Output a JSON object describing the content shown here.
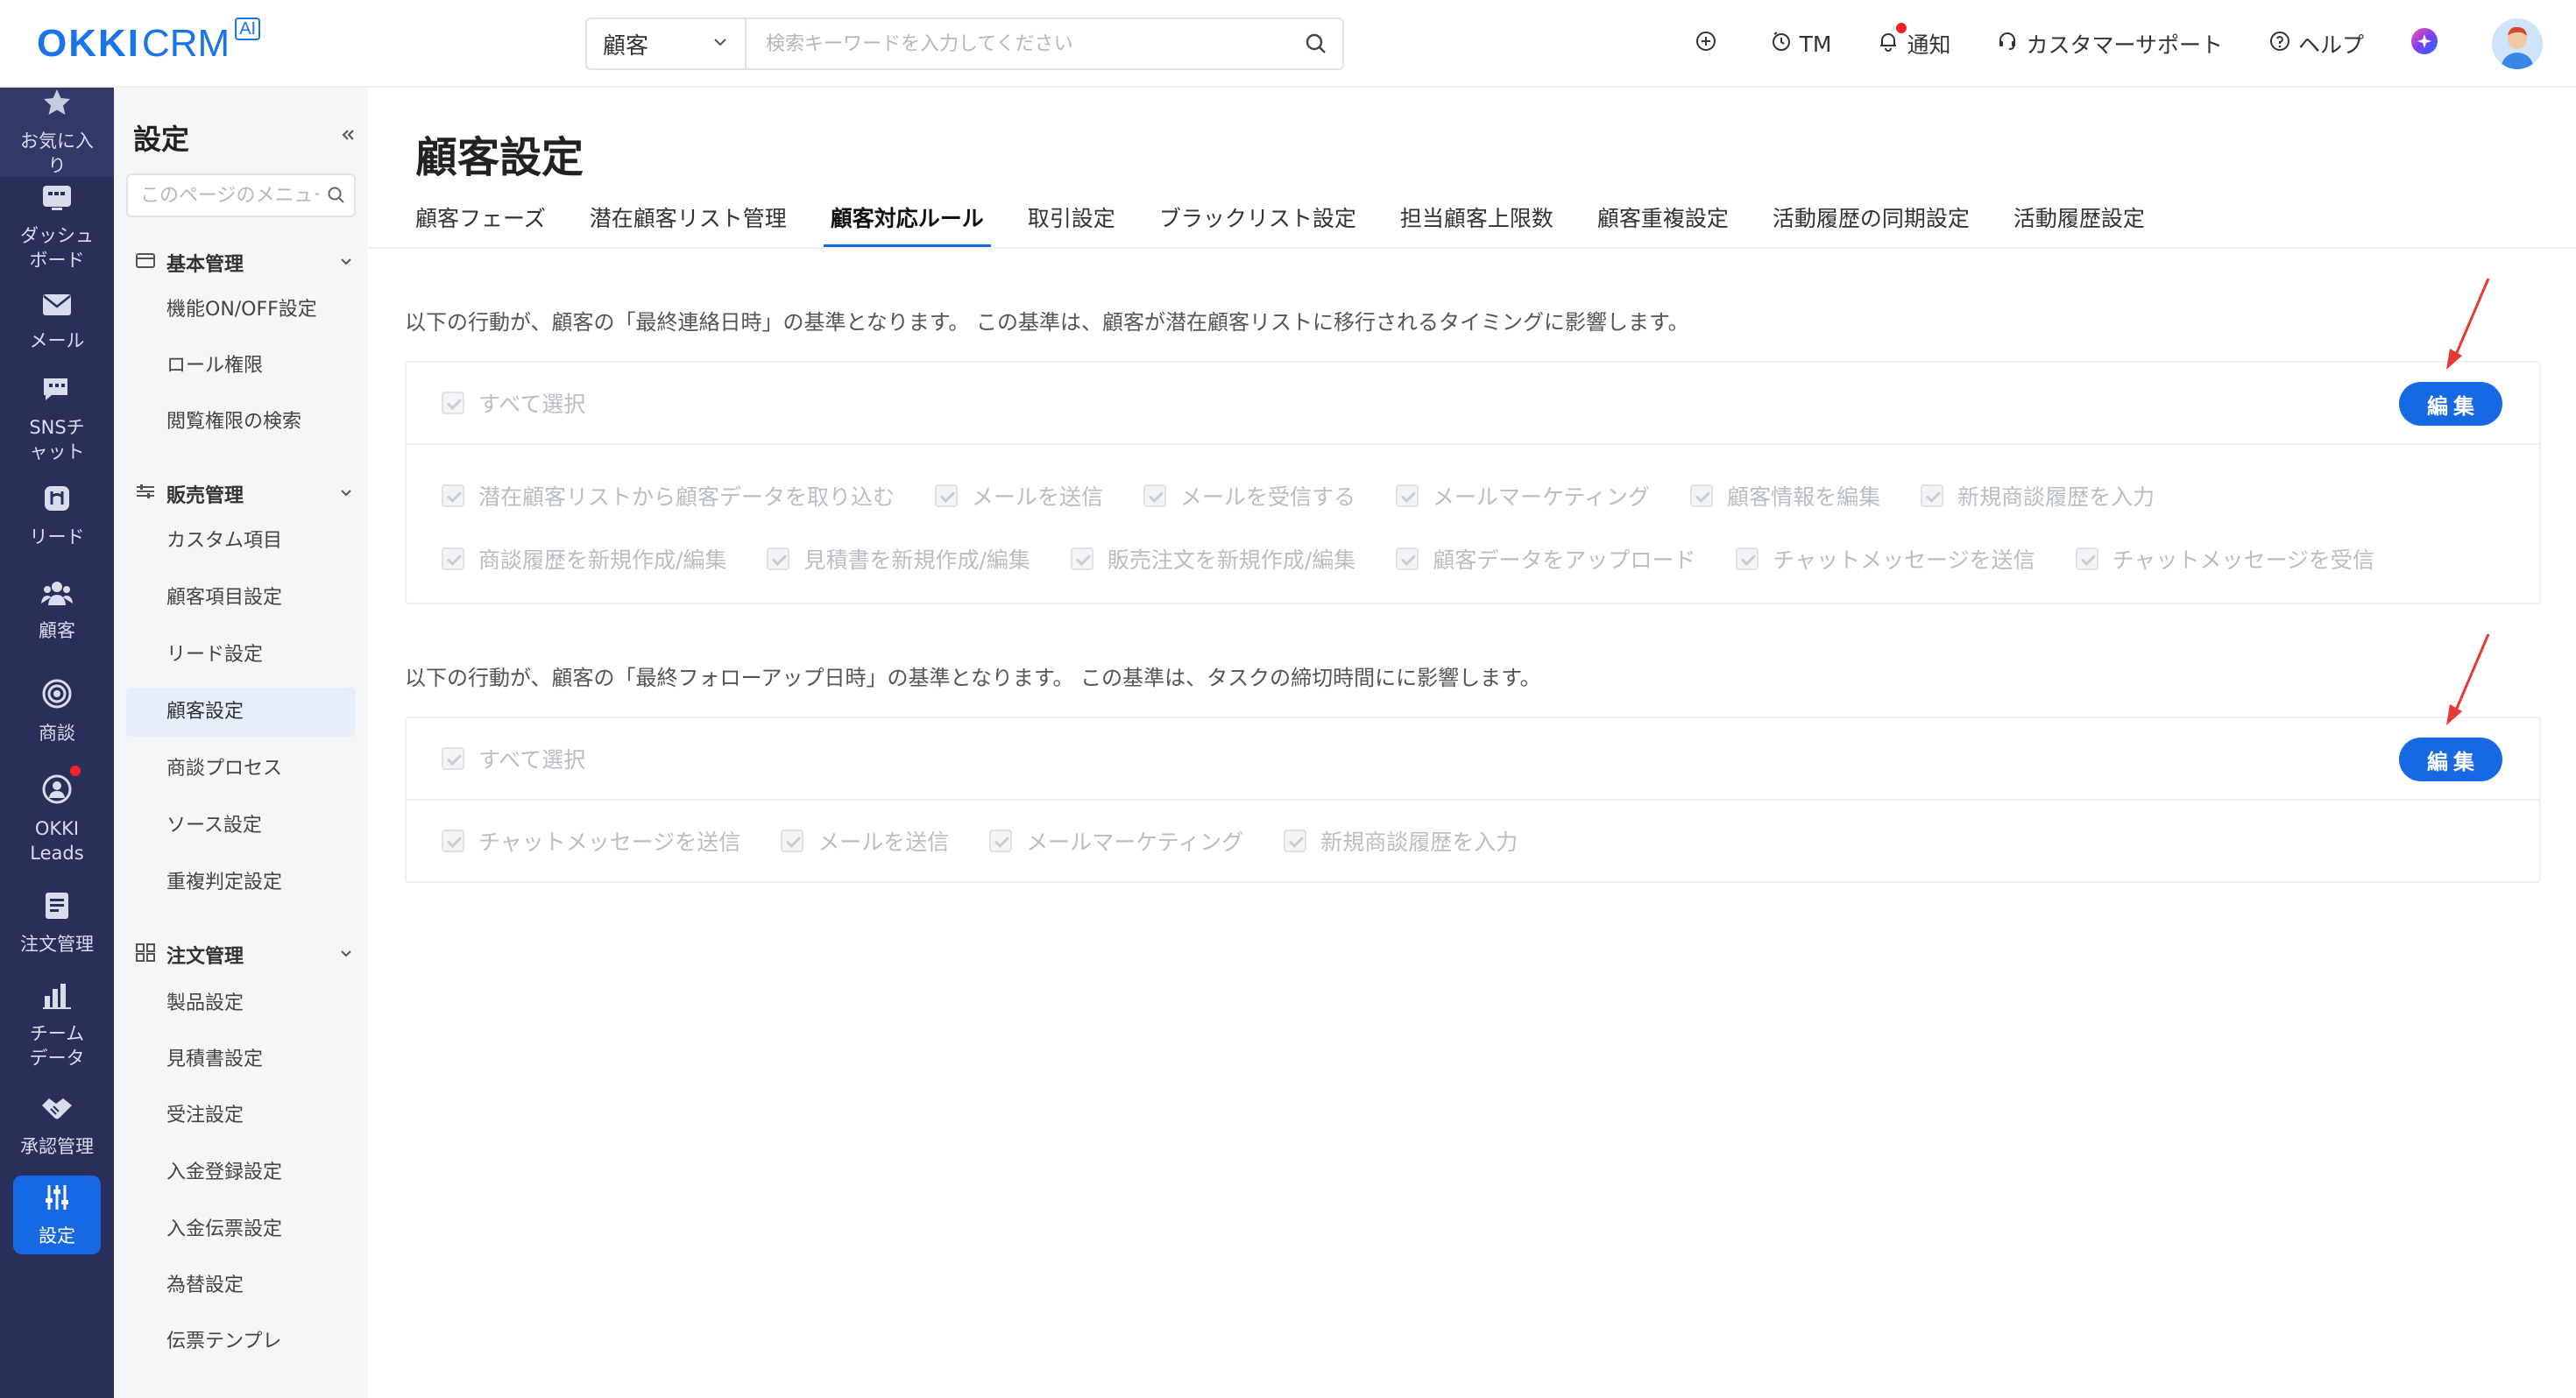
{
  "header": {
    "logo_main": "OKKI",
    "logo_sub": "CRM",
    "logo_badge": "AI",
    "search_select": "顧客",
    "search_placeholder": "検索キーワードを入力してください",
    "tm": "TM",
    "notice": "通知",
    "support": "カスタマーサポート",
    "help": "ヘルプ"
  },
  "leftnav": {
    "items": [
      {
        "label": "お気に入り",
        "icon": "star-icon"
      },
      {
        "label": "ダッシュボード",
        "icon": "dashboard-icon"
      },
      {
        "label": "メール",
        "icon": "mail-icon"
      },
      {
        "label": "SNSチャット",
        "icon": "chat-icon"
      },
      {
        "label": "リード",
        "icon": "lead-icon"
      },
      {
        "label": "顧客",
        "icon": "customers-icon"
      },
      {
        "label": "商談",
        "icon": "target-icon"
      },
      {
        "label": "OKKI Leads",
        "icon": "okki-leads-icon"
      },
      {
        "label": "注文管理",
        "icon": "order-icon"
      },
      {
        "label": "チームデータ",
        "icon": "bar-chart-icon"
      },
      {
        "label": "承認管理",
        "icon": "handshake-icon"
      },
      {
        "label": "設定",
        "icon": "settings-sliders-icon"
      }
    ]
  },
  "submenu": {
    "title": "設定",
    "search_placeholder": "このページのメニュー",
    "groups": [
      {
        "label": "基本管理",
        "items": [
          "機能ON/OFF設定",
          "ロール権限",
          "閲覧権限の検索"
        ]
      },
      {
        "label": "販売管理",
        "items": [
          "カスタム項目",
          "顧客項目設定",
          "リード設定",
          "顧客設定",
          "商談プロセス",
          "ソース設定",
          "重複判定設定"
        ]
      },
      {
        "label": "注文管理",
        "items": [
          "製品設定",
          "見積書設定",
          "受注設定",
          "入金登録設定",
          "入金伝票設定",
          "為替設定",
          "伝票テンプレ"
        ]
      }
    ],
    "active_item": "顧客設定"
  },
  "main": {
    "title": "顧客設定",
    "tabs": [
      "顧客フェーズ",
      "潜在顧客リスト管理",
      "顧客対応ルール",
      "取引設定",
      "ブラックリスト設定",
      "担当顧客上限数",
      "顧客重複設定",
      "活動履歴の同期設定",
      "活動履歴設定"
    ],
    "active_tab": "顧客対応ルール",
    "section1": {
      "desc": "以下の行動が、顧客の「最終連絡日時」の基準となります。 この基準は、顧客が潜在顧客リストに移行されるタイミングに影響します。",
      "select_all": "すべて選択",
      "edit": "編集",
      "row1": [
        "潜在顧客リストから顧客データを取り込む",
        "メールを送信",
        "メールを受信する",
        "メールマーケティング",
        "顧客情報を編集",
        "新規商談履歴を入力"
      ],
      "row2": [
        "商談履歴を新規作成/編集",
        "見積書を新規作成/編集",
        "販売注文を新規作成/編集",
        "顧客データをアップロード",
        "チャットメッセージを送信",
        "チャットメッセージを受信"
      ]
    },
    "section2": {
      "desc": "以下の行動が、顧客の「最終フォローアップ日時」の基準となります。 この基準は、タスクの締切時間にに影響します。",
      "select_all": "すべて選択",
      "edit": "編集",
      "row1": [
        "チャットメッセージを送信",
        "メールを送信",
        "メールマーケティング",
        "新規商談履歴を入力"
      ]
    }
  },
  "colors": {
    "brand": "#1a73e8",
    "primary_button": "#1668e3",
    "nav_bg": "#2a2f5a",
    "annotation_arrow": "#e53935"
  }
}
